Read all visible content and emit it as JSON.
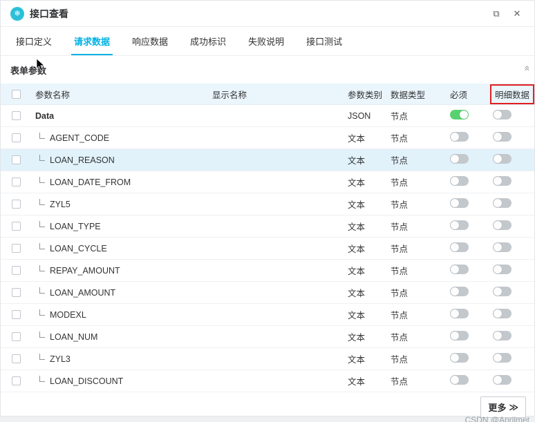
{
  "window": {
    "title": "接口查看",
    "expand_icon": "⧉",
    "close_icon": "✕",
    "app_icon": "❄"
  },
  "tabs": [
    {
      "label": "接口定义",
      "active": false
    },
    {
      "label": "请求数据",
      "active": true
    },
    {
      "label": "响应数据",
      "active": false
    },
    {
      "label": "成功标识",
      "active": false
    },
    {
      "label": "失败说明",
      "active": false
    },
    {
      "label": "接口测试",
      "active": false
    }
  ],
  "section": {
    "title": "表单参数",
    "collapse_icon": "»"
  },
  "table": {
    "columns": [
      "参数名称",
      "显示名称",
      "参数类别",
      "数据类型",
      "必须",
      "明细数据"
    ],
    "highlighted_column": "明细数据",
    "rows": [
      {
        "name": "Data",
        "display": "",
        "category": "JSON",
        "type": "节点",
        "required": true,
        "detail": false,
        "child": false,
        "selected": false
      },
      {
        "name": "AGENT_CODE",
        "display": "",
        "category": "文本",
        "type": "节点",
        "required": false,
        "detail": false,
        "child": true,
        "selected": false
      },
      {
        "name": "LOAN_REASON",
        "display": "",
        "category": "文本",
        "type": "节点",
        "required": false,
        "detail": false,
        "child": true,
        "selected": true
      },
      {
        "name": "LOAN_DATE_FROM",
        "display": "",
        "category": "文本",
        "type": "节点",
        "required": false,
        "detail": false,
        "child": true,
        "selected": false
      },
      {
        "name": "ZYL5",
        "display": "",
        "category": "文本",
        "type": "节点",
        "required": false,
        "detail": false,
        "child": true,
        "selected": false
      },
      {
        "name": "LOAN_TYPE",
        "display": "",
        "category": "文本",
        "type": "节点",
        "required": false,
        "detail": false,
        "child": true,
        "selected": false
      },
      {
        "name": "LOAN_CYCLE",
        "display": "",
        "category": "文本",
        "type": "节点",
        "required": false,
        "detail": false,
        "child": true,
        "selected": false
      },
      {
        "name": "REPAY_AMOUNT",
        "display": "",
        "category": "文本",
        "type": "节点",
        "required": false,
        "detail": false,
        "child": true,
        "selected": false
      },
      {
        "name": "LOAN_AMOUNT",
        "display": "",
        "category": "文本",
        "type": "节点",
        "required": false,
        "detail": false,
        "child": true,
        "selected": false
      },
      {
        "name": "MODEXL",
        "display": "",
        "category": "文本",
        "type": "节点",
        "required": false,
        "detail": false,
        "child": true,
        "selected": false
      },
      {
        "name": "LOAN_NUM",
        "display": "",
        "category": "文本",
        "type": "节点",
        "required": false,
        "detail": false,
        "child": true,
        "selected": false
      },
      {
        "name": "ZYL3",
        "display": "",
        "category": "文本",
        "type": "节点",
        "required": false,
        "detail": false,
        "child": true,
        "selected": false
      },
      {
        "name": "LOAN_DISCOUNT",
        "display": "",
        "category": "文本",
        "type": "节点",
        "required": false,
        "detail": false,
        "child": true,
        "selected": false
      }
    ]
  },
  "footer": {
    "more_label": "更多",
    "more_icon": "≫"
  },
  "watermark": "CSDN @Aprilmet",
  "colors": {
    "accent": "#00b2e3",
    "toggle_on": "#57d26f",
    "header_bg": "#eaf5fc",
    "selected_row_bg": "#e1f2fb",
    "annotation_red": "#e02020"
  }
}
